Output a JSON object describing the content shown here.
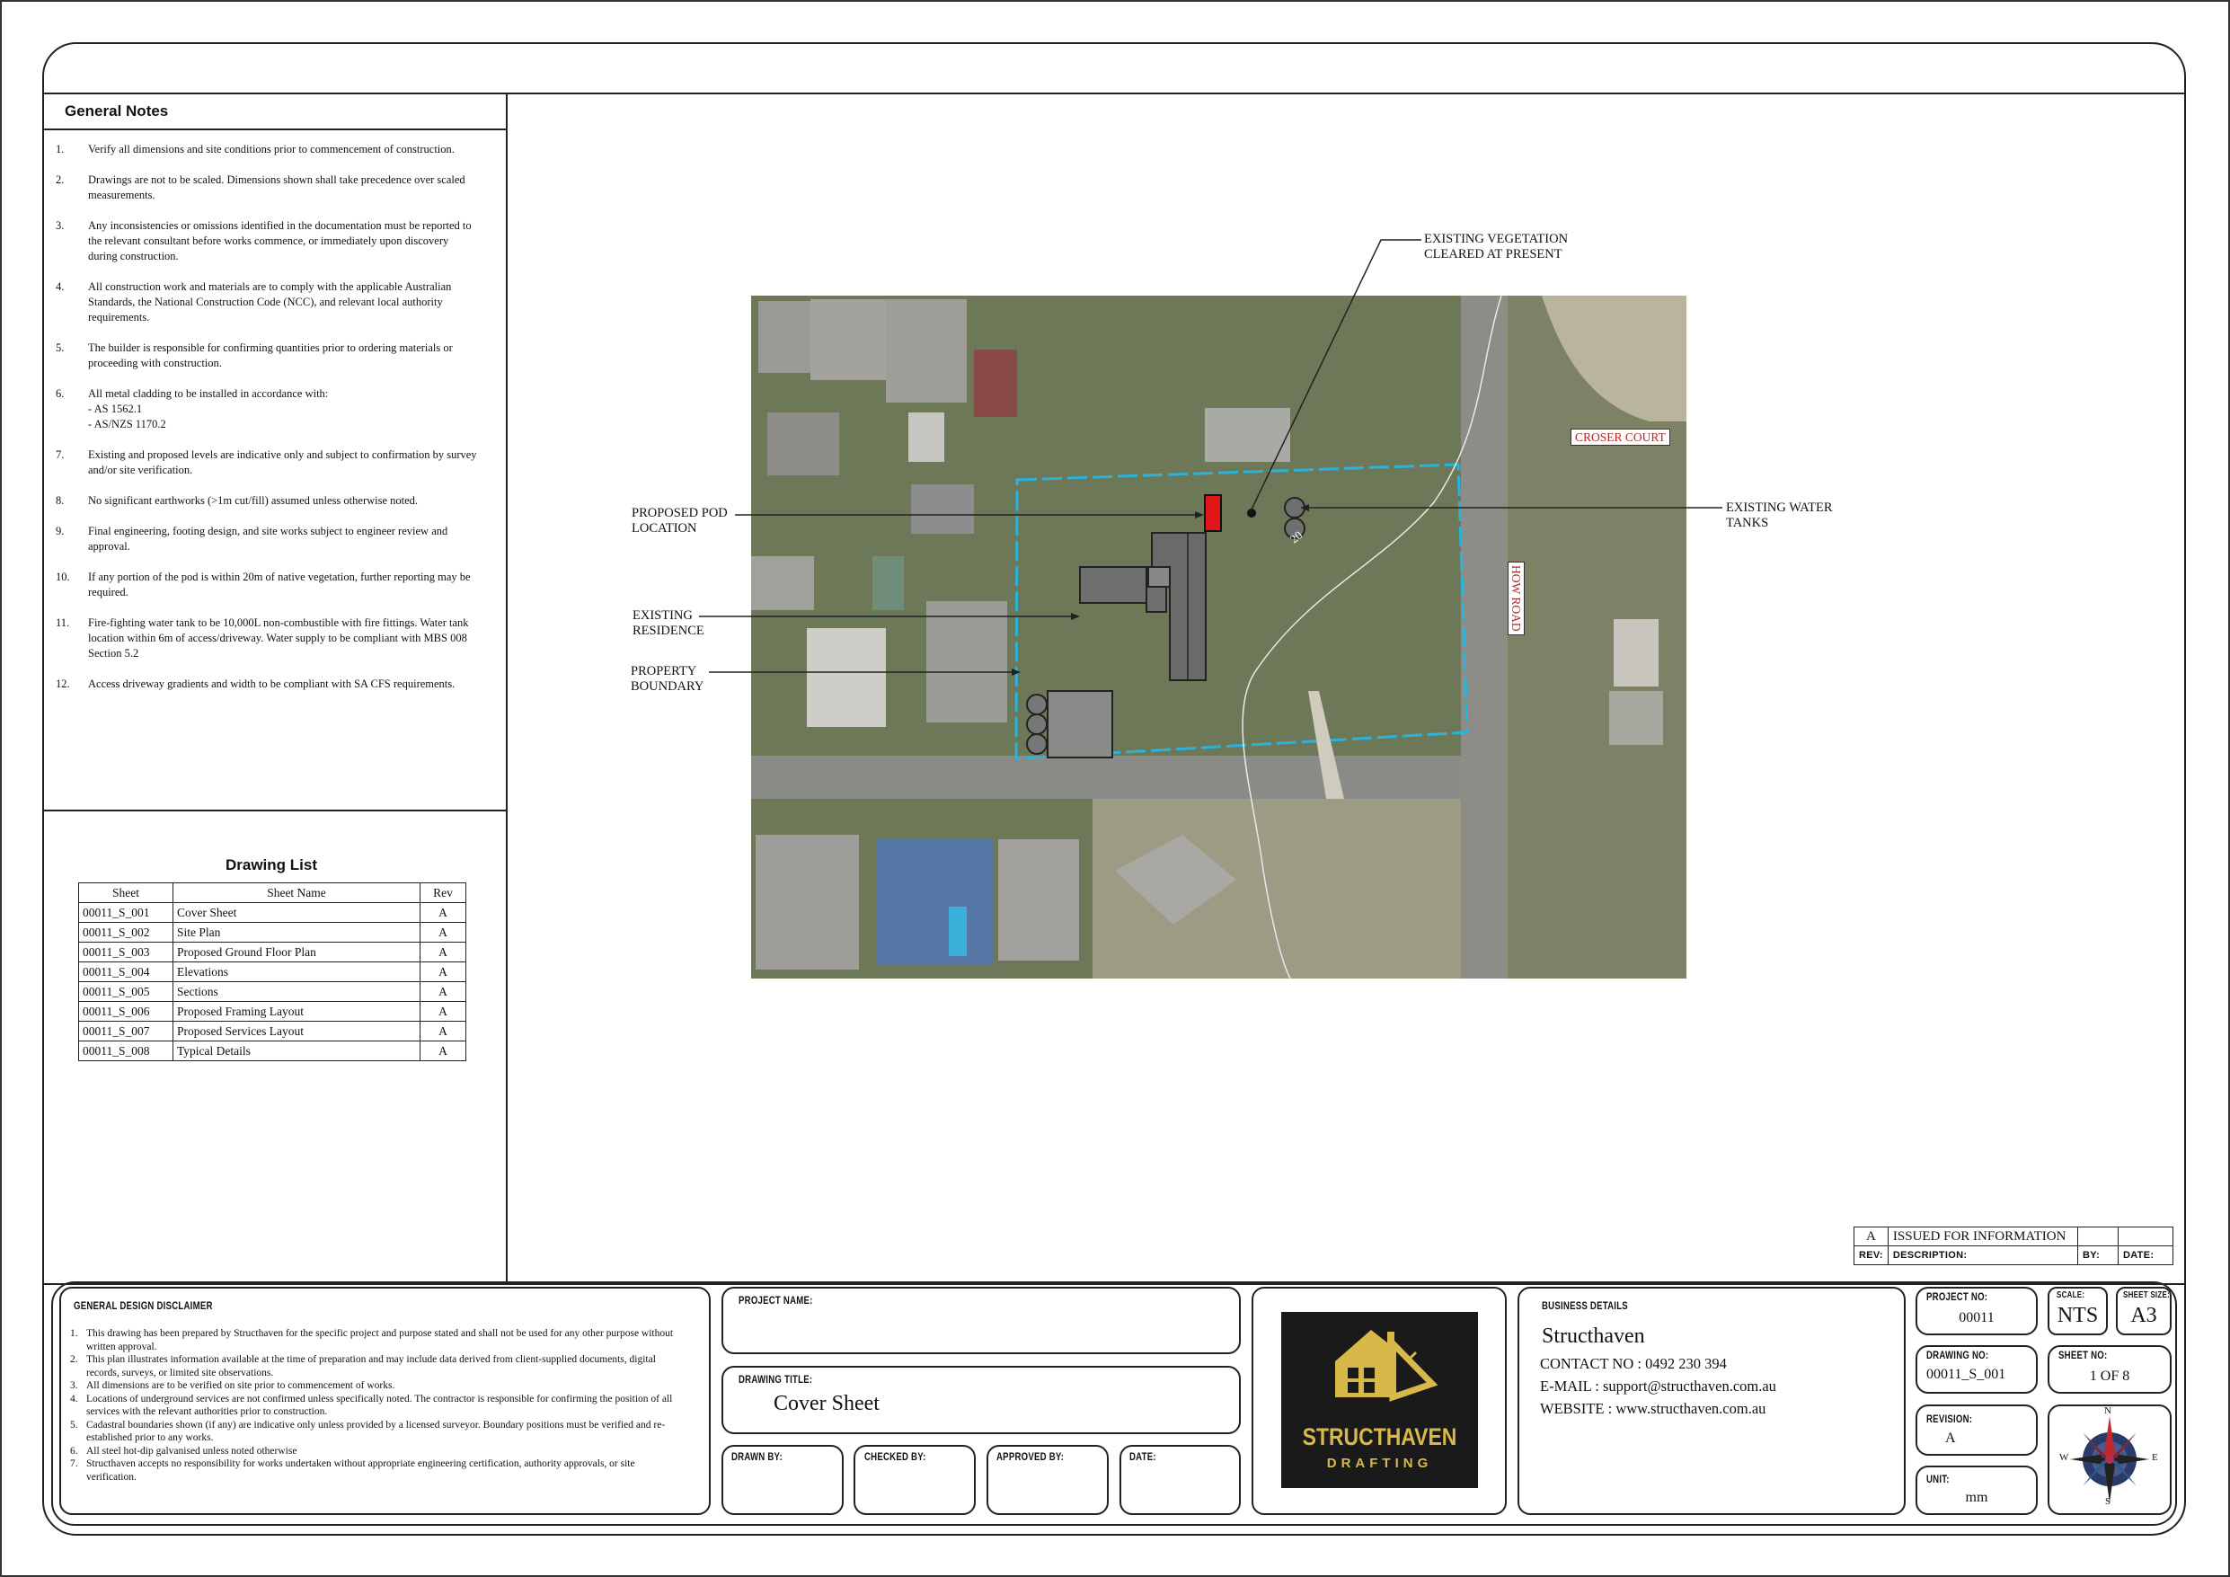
{
  "general_notes": {
    "title": "General Notes",
    "items": [
      {
        "num": "1.",
        "text": "Verify all dimensions and site conditions prior to commencement of construction."
      },
      {
        "num": "2.",
        "text": "Drawings are not to be scaled. Dimensions shown shall take precedence over scaled measurements."
      },
      {
        "num": "3.",
        "text": "Any inconsistencies or omissions identified in the documentation must be reported to the relevant consultant before works commence, or immediately upon discovery during construction."
      },
      {
        "num": "4.",
        "text": "All construction work and materials are to comply with the applicable Australian Standards, the National Construction Code (NCC), and relevant local authority requirements."
      },
      {
        "num": "5.",
        "text": "The builder is responsible for confirming quantities prior to ordering materials or proceeding with construction."
      },
      {
        "num": "6.",
        "text": "All metal cladding to be installed in accordance with:",
        "sub1": "- AS 1562.1",
        "sub2": "- AS/NZS 1170.2"
      },
      {
        "num": "7.",
        "text": "Existing and proposed levels are indicative only and subject to confirmation by survey and/or site verification."
      },
      {
        "num": "8.",
        "text": "No significant earthworks (>1m cut/fill) assumed unless otherwise noted."
      },
      {
        "num": "9.",
        "text": "Final engineering, footing design, and site works subject to engineer review and approval."
      },
      {
        "num": "10.",
        "text": "If any portion of the pod is within 20m of native vegetation, further reporting may be required."
      },
      {
        "num": "11.",
        "text": "Fire-fighting water tank to be 10,000L non-combustible with fire fittings. Water tank location within 6m of access/driveway. Water supply to be compliant with MBS 008 Section 5.2"
      },
      {
        "num": "12.",
        "text": "Access driveway gradients and width to be compliant with SA CFS requirements."
      }
    ]
  },
  "drawing_list": {
    "title": "Drawing List",
    "headers": [
      "Sheet",
      "Sheet Name",
      "Rev"
    ],
    "rows": [
      [
        "00011_S_001",
        "Cover Sheet",
        "A"
      ],
      [
        "00011_S_002",
        "Site Plan",
        "A"
      ],
      [
        "00011_S_003",
        "Proposed Ground Floor Plan",
        "A"
      ],
      [
        "00011_S_004",
        "Elevations",
        "A"
      ],
      [
        "00011_S_005",
        "Sections",
        "A"
      ],
      [
        "00011_S_006",
        "Proposed Framing Layout",
        "A"
      ],
      [
        "00011_S_007",
        "Proposed Services Layout",
        "A"
      ],
      [
        "00011_S_008",
        "Typical Details",
        "A"
      ]
    ]
  },
  "map": {
    "veg_label_1": "EXISTING VEGETATION",
    "veg_label_2": "CLEARED AT PRESENT",
    "pod_label_1": "PROPOSED POD",
    "pod_label_2": "LOCATION",
    "residence_label_1": "EXISTING",
    "residence_label_2": "RESIDENCE",
    "boundary_label_1": "PROPERTY",
    "boundary_label_2": "BOUNDARY",
    "tanks_label_1": "EXISTING WATER",
    "tanks_label_2": "TANKS",
    "croser_court": "CROSER COURT",
    "how_road": "HOW ROAD",
    "contour": "20"
  },
  "revisions": {
    "rows": [
      {
        "rev": "A",
        "description": "ISSUED FOR INFORMATION",
        "by": "",
        "date": ""
      }
    ],
    "header_rev": "REV:",
    "header_desc": "DESCRIPTION:",
    "header_by": "BY:",
    "header_date": "DATE:"
  },
  "disclaimer": {
    "title": "GENERAL DESIGN DISCLAIMER",
    "items": [
      {
        "num": "1.",
        "text": "This drawing has been prepared by Structhaven for the specific project and purpose stated and shall not be used for any other purpose without written approval."
      },
      {
        "num": "2.",
        "text": "This plan illustrates information available at the time of preparation and may include data derived from client-supplied documents, digital records, surveys, or limited site observations."
      },
      {
        "num": "3.",
        "text": "All dimensions are to be verified on site prior to commencement of works."
      },
      {
        "num": "4.",
        "text": "Locations of underground services are not confirmed unless specifically noted. The contractor is responsible for confirming the position of all services with the relevant authorities prior to construction."
      },
      {
        "num": "5.",
        "text": "Cadastral boundaries shown (if any) are indicative only unless provided by a licensed surveyor. Boundary positions must be verified and re-established prior to any works."
      },
      {
        "num": "6.",
        "text": "All steel hot-dip galvanised unless noted otherwise"
      },
      {
        "num": "7.",
        "text": "Structhaven accepts no responsibility for works undertaken without appropriate engineering certification, authority approvals, or site verification."
      }
    ]
  },
  "project": {
    "project_name_label": "PROJECT NAME:",
    "project_name": "",
    "drawing_title_label": "DRAWING TITLE:",
    "drawing_title": "Cover Sheet",
    "drawn_by_label": "DRAWN BY:",
    "checked_by_label": "CHECKED BY:",
    "approved_by_label": "APPROVED BY:",
    "date_label": "DATE:"
  },
  "logo": {
    "word1": "STRUCTHAVEN",
    "word2": "DRAFTING",
    "bg": "#1a1a1a",
    "gold": "#d9b84a"
  },
  "business": {
    "label": "BUSINESS DETAILS",
    "name": "Structhaven",
    "contact": "CONTACT NO : 0492 230 394",
    "email": "E-MAIL : support@structhaven.com.au",
    "website": "WEBSITE : www.structhaven.com.au"
  },
  "sheet_info": {
    "project_no_label": "PROJECT NO:",
    "project_no": "00011",
    "scale_label": "SCALE:",
    "scale": "NTS",
    "sheet_size_label": "SHEET SIZE:",
    "sheet_size": "A3",
    "drawing_no_label": "DRAWING NO:",
    "drawing_no": "00011_S_001",
    "sheet_no_label": "SHEET NO:",
    "sheet_no": "1 OF 8",
    "revision_label": "REVISION:",
    "revision": "A",
    "unit_label": "UNIT:",
    "unit": "mm",
    "compass_n": "N",
    "compass_s": "S",
    "compass_e": "E",
    "compass_w": "W"
  },
  "colors": {
    "boundary": "#2bb3d9",
    "pod": "#e01515",
    "road_label": "#b02a2a"
  }
}
